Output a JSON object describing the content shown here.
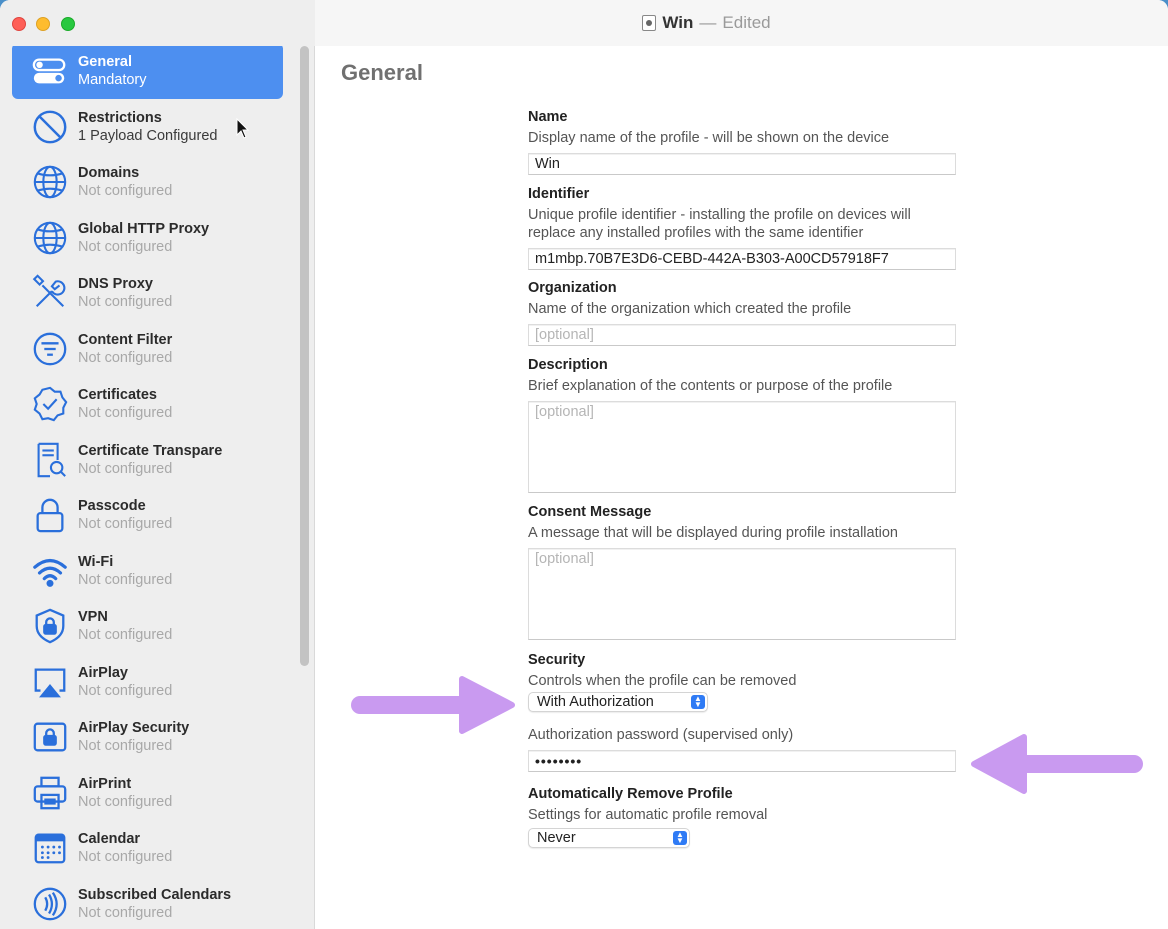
{
  "window": {
    "title": "Win",
    "separator": "—",
    "state": "Edited"
  },
  "sidebar": {
    "items": [
      {
        "title": "General",
        "sub": "Mandatory",
        "icon": "toggles-icon"
      },
      {
        "title": "Restrictions",
        "sub": "1 Payload Configured",
        "icon": "prohibited-icon"
      },
      {
        "title": "Domains",
        "sub": "Not configured",
        "icon": "globe-icon"
      },
      {
        "title": "Global HTTP Proxy",
        "sub": "Not configured",
        "icon": "globe-icon"
      },
      {
        "title": "DNS Proxy",
        "sub": "Not configured",
        "icon": "tools-icon"
      },
      {
        "title": "Content Filter",
        "sub": "Not configured",
        "icon": "filter-icon"
      },
      {
        "title": "Certificates",
        "sub": "Not configured",
        "icon": "certificate-badge-icon"
      },
      {
        "title": "Certificate Transpare",
        "sub": "Not configured",
        "icon": "document-search-icon"
      },
      {
        "title": "Passcode",
        "sub": "Not configured",
        "icon": "lock-icon"
      },
      {
        "title": "Wi-Fi",
        "sub": "Not configured",
        "icon": "wifi-icon"
      },
      {
        "title": "VPN",
        "sub": "Not configured",
        "icon": "shield-lock-icon"
      },
      {
        "title": "AirPlay",
        "sub": "Not configured",
        "icon": "airplay-icon"
      },
      {
        "title": "AirPlay Security",
        "sub": "Not configured",
        "icon": "airplay-lock-icon"
      },
      {
        "title": "AirPrint",
        "sub": "Not configured",
        "icon": "printer-icon"
      },
      {
        "title": "Calendar",
        "sub": "Not configured",
        "icon": "calendar-icon"
      },
      {
        "title": "Subscribed Calendars",
        "sub": "Not configured",
        "icon": "subscribed-calendar-icon"
      }
    ]
  },
  "main": {
    "title": "General",
    "name": {
      "label": "Name",
      "desc": "Display name of the profile - will be shown on the device",
      "value": "Win"
    },
    "identifier": {
      "label": "Identifier",
      "desc1": "Unique profile identifier - installing the profile on devices will",
      "desc2": "replace any installed profiles with the same identifier",
      "value": "m1mbp.70B7E3D6-CEBD-442A-B303-A00CD57918F7"
    },
    "organization": {
      "label": "Organization",
      "desc": "Name of the organization which created the profile",
      "placeholder": "[optional]"
    },
    "description": {
      "label": "Description",
      "desc": "Brief explanation of the contents or purpose of the profile",
      "placeholder": "[optional]"
    },
    "consent": {
      "label": "Consent Message",
      "desc": "A message that will be displayed during profile installation",
      "placeholder": "[optional]"
    },
    "security": {
      "label": "Security",
      "desc": "Controls when the profile can be removed",
      "selected": "With Authorization",
      "password_label": "Authorization password (supervised only)",
      "password_value": "••••••••"
    },
    "auto_remove": {
      "label": "Automatically Remove Profile",
      "desc": "Settings for automatic profile removal",
      "selected": "Never"
    }
  },
  "colors": {
    "accent": "#4d8ff0",
    "annotation_arrow": "#c99af0"
  }
}
